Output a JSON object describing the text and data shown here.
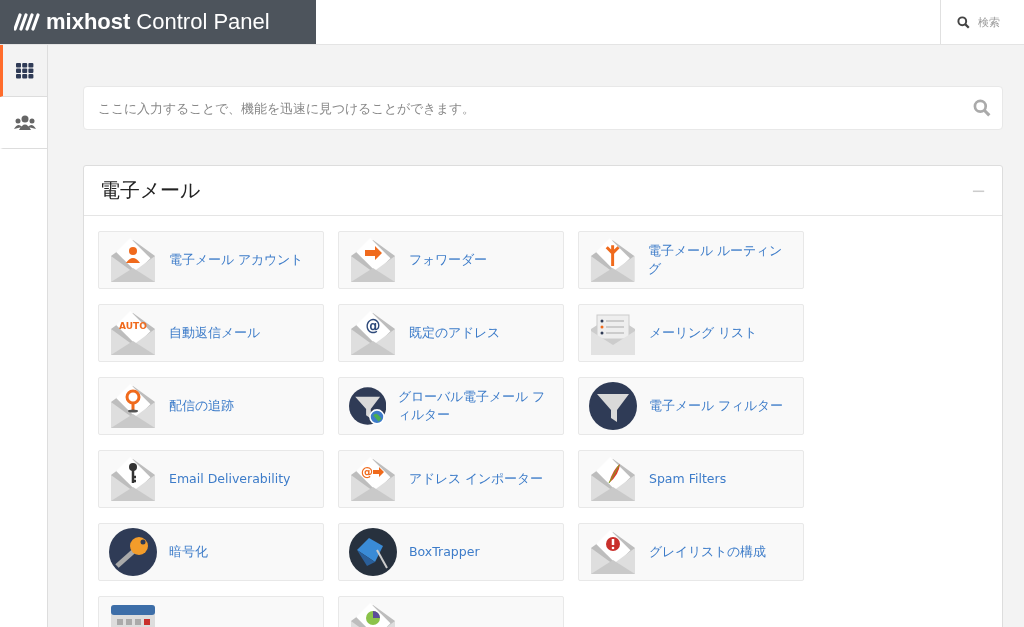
{
  "header": {
    "logo_brand": "mixhost",
    "logo_product": "Control Panel",
    "search_label": "検索"
  },
  "sidebar": {
    "items": [
      {
        "kind": "grid",
        "selected": true
      },
      {
        "kind": "users",
        "selected": false
      }
    ]
  },
  "search": {
    "placeholder": "ここに入力することで、機能を迅速に見つけることができます。"
  },
  "section": {
    "title": "電子メール",
    "collapse": "−",
    "tiles": [
      {
        "label": "電子メール アカウント",
        "kind": "person"
      },
      {
        "label": "フォワーダー",
        "kind": "arrow"
      },
      {
        "label": "電子メール ルーティング",
        "kind": "routing"
      },
      {
        "label": "自動返信メール",
        "kind": "auto",
        "badge_text": "AUTO"
      },
      {
        "label": "既定のアドレス",
        "kind": "at",
        "badge_text": "@"
      },
      {
        "label": "メーリング リスト",
        "kind": "list"
      },
      {
        "label": "配信の追跡",
        "kind": "pin"
      },
      {
        "label": "グローバル電子メール フィルター",
        "kind": "globefilter"
      },
      {
        "label": "電子メール フィルター",
        "kind": "filter"
      },
      {
        "label": "Email Deliverability",
        "kind": "key"
      },
      {
        "label": "アドレス インポーター",
        "kind": "atarrow",
        "badge_text": "@"
      },
      {
        "label": "Spam Filters",
        "kind": "feather"
      },
      {
        "label": "暗号化",
        "kind": "gpgkey"
      },
      {
        "label": "BoxTrapper",
        "kind": "trap"
      },
      {
        "label": "グレイリストの構成",
        "kind": "alert"
      },
      {
        "kind": "calendar"
      },
      {
        "kind": "pie"
      }
    ]
  }
}
